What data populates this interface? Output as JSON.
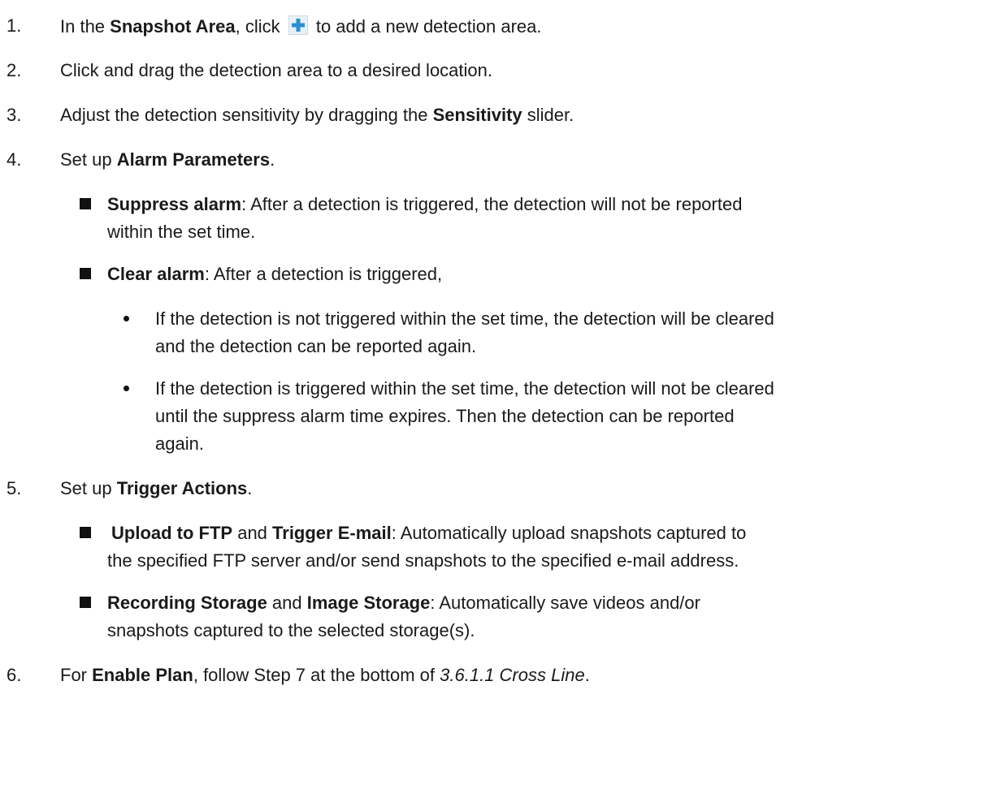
{
  "steps": [
    {
      "num": "1.",
      "parts": [
        "In the ",
        "Snapshot Area",
        ", click ",
        " to add a new detection area."
      ],
      "icon": "plus-icon"
    },
    {
      "num": "2.",
      "parts": [
        "Click and drag the detection area to a desired location."
      ]
    },
    {
      "num": "3.",
      "parts": [
        "Adjust the detection sensitivity by dragging the ",
        "Sensitivity",
        " slider."
      ]
    },
    {
      "num": "4.",
      "parts": [
        "Set up ",
        "Alarm Parameters",
        "."
      ],
      "items": [
        {
          "parts": [
            "Suppress alarm",
            ": After a detection is triggered, the detection will not be reported"
          ],
          "cont": "within the set time."
        },
        {
          "parts": [
            "Clear alarm",
            ": After a detection is triggered,"
          ],
          "bullets": [
            {
              "line1": "If the detection is not triggered within the set time, the detection will be cleared",
              "line2": "and the detection can be reported again."
            },
            {
              "line1": "If the detection is triggered within the set time, the detection will not be cleared",
              "line2": "until the suppress alarm time expires. Then the detection can be reported",
              "line3": "again."
            }
          ]
        }
      ]
    },
    {
      "num": "5.",
      "parts": [
        "Set up ",
        "Trigger Actions",
        "."
      ],
      "items": [
        {
          "parts": [
            "Upload to FTP",
            " and ",
            "Trigger E-mail",
            ": Automatically upload snapshots captured to"
          ],
          "cont": "the specified FTP server and/or send snapshots to the specified e-mail address."
        },
        {
          "parts": [
            "Recording Storage",
            " and ",
            "Image Storage",
            ": Automatically save videos and/or"
          ],
          "cont": "snapshots captured to the selected storage(s)."
        }
      ]
    },
    {
      "num": "6.",
      "parts": [
        "For ",
        "Enable Plan",
        ", follow Step 7 at the bottom of ",
        "3.6.1.1 Cross Line",
        "."
      ]
    }
  ],
  "icon_colors": {
    "plus": "#2a8fd1"
  }
}
